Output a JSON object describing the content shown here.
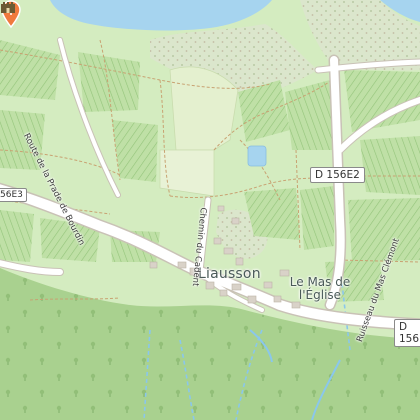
{
  "map": {
    "place_labels": {
      "village": "Liausson",
      "hamlet": "Le Mas de l'Église"
    },
    "street_labels": {
      "route_west": "Route de la Prade de Bourdin",
      "chemin": "Chemin du Cadent",
      "ruisseau": "Ruisseau du Mas Clémont"
    },
    "road_shields": {
      "d156e2": "D 156E2",
      "d156_clipped": "D 156",
      "d156e3_clipped": "56E3"
    },
    "markers": {
      "poi_pin": "location-pin-icon",
      "castle": "castle-icon"
    },
    "colors": {
      "lake": "#a6d4ef",
      "grass": "#d4ecc0",
      "vineyard": "#b9df9f",
      "forest": "#a8d08d",
      "scrub": "#dfe6cf",
      "road": "#ffffff",
      "stream": "#8ac7ec",
      "pin": "#f07a3e"
    }
  }
}
